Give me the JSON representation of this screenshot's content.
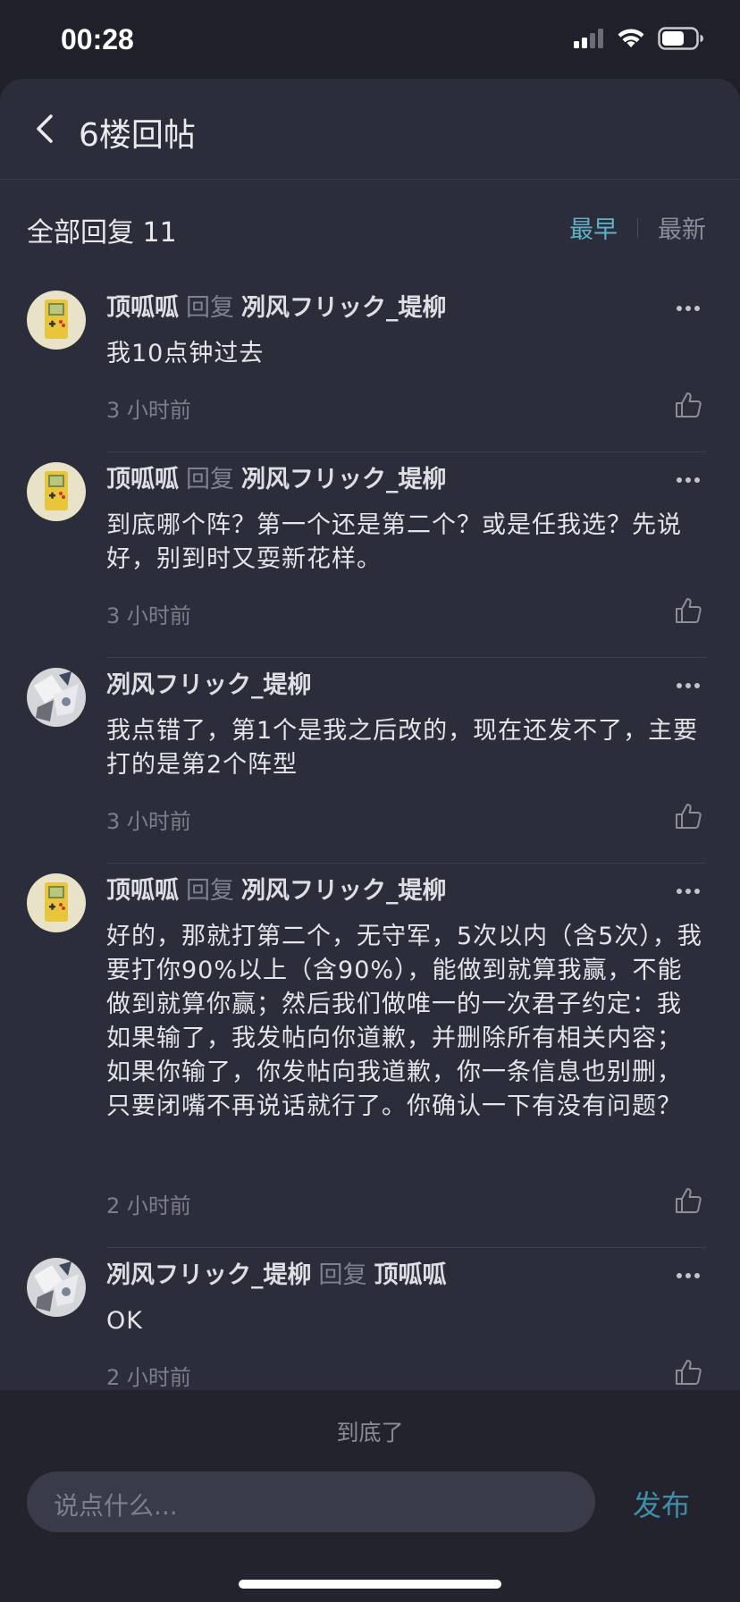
{
  "status_bar": {
    "time": "00:28"
  },
  "nav": {
    "title": "6楼回帖"
  },
  "section": {
    "title": "全部回复 11",
    "sort_options": [
      "最早",
      "最新"
    ],
    "active_sort": "最早"
  },
  "comments": [
    {
      "user": "顶呱呱",
      "reply_word": "回复",
      "reply_to": "冽风フリック_堤柳",
      "text": "我10点钟过去",
      "time": "3 小时前"
    },
    {
      "user": "顶呱呱",
      "reply_word": "回复",
      "reply_to": "冽风フリック_堤柳",
      "text": "到底哪个阵？第一个还是第二个？或是任我选？先说好，别到时又耍新花样。",
      "time": "3 小时前"
    },
    {
      "user": "冽风フリック_堤柳",
      "reply_word": "",
      "reply_to": "",
      "text": "我点错了，第1个是我之后改的，现在还发不了，主要打的是第2个阵型",
      "time": "3 小时前"
    },
    {
      "user": "顶呱呱",
      "reply_word": "回复",
      "reply_to": "冽风フリック_堤柳",
      "text": "好的，那就打第二个，无守军，5次以内（含5次），我要打你90%以上（含90%），能做到就算我赢，不能做到就算你赢；然后我们做唯一的一次君子约定：我如果输了，我发帖向你道歉，并删除所有相关内容；如果你输了，你发帖向我道歉，你一条信息也别删，只要闭嘴不再说话就行了。你确认一下有没有问题？",
      "time": "2 小时前"
    },
    {
      "user": "冽风フリック_堤柳",
      "reply_word": "回复",
      "reply_to": "顶呱呱",
      "text": "OK",
      "time": "2 小时前"
    }
  ],
  "footer": {
    "end_text": "到底了",
    "input_placeholder": "说点什么...",
    "publish_label": "发布"
  },
  "colors": {
    "accent": "#5fb1c9",
    "publish": "#3f8fa8",
    "background": "#2c2d3a"
  }
}
